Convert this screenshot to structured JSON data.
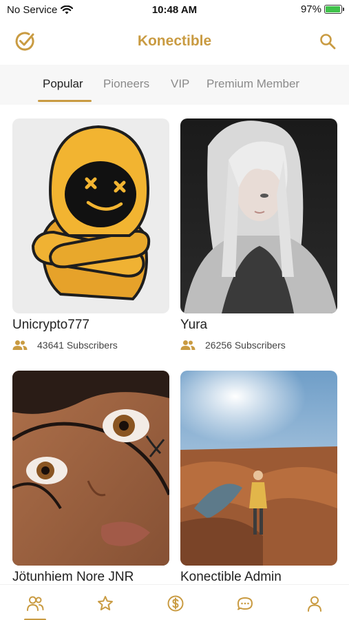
{
  "status_bar": {
    "carrier": "No Service",
    "time": "10:48 AM",
    "battery": "97%",
    "battery_level": 0.97
  },
  "header": {
    "title": "Konectible",
    "left_icon": "check-circle-icon",
    "right_icon": "search-icon"
  },
  "tabs": [
    {
      "label": "Popular",
      "active": true
    },
    {
      "label": "Pioneers",
      "active": false
    },
    {
      "label": "VIP",
      "active": false
    },
    {
      "label": "Premium Member",
      "active": false
    }
  ],
  "cards": [
    {
      "name": "Unicrypto777",
      "subscribers": "43641 Subscribers"
    },
    {
      "name": "Yura",
      "subscribers": "26256 Subscribers"
    },
    {
      "name": "Jötunhiem Nore JNR"
    },
    {
      "name": "Konectible Admin"
    }
  ],
  "bottom_nav": [
    {
      "icon": "people-icon",
      "active": true
    },
    {
      "icon": "star-icon",
      "active": false
    },
    {
      "icon": "dollar-icon",
      "active": false
    },
    {
      "icon": "chat-icon",
      "active": false
    },
    {
      "icon": "profile-icon",
      "active": false
    }
  ],
  "colors": {
    "accent": "#C99B42",
    "text": "#222222",
    "muted": "#8a8a8a",
    "tabbar_bg": "#f7f7f7"
  }
}
